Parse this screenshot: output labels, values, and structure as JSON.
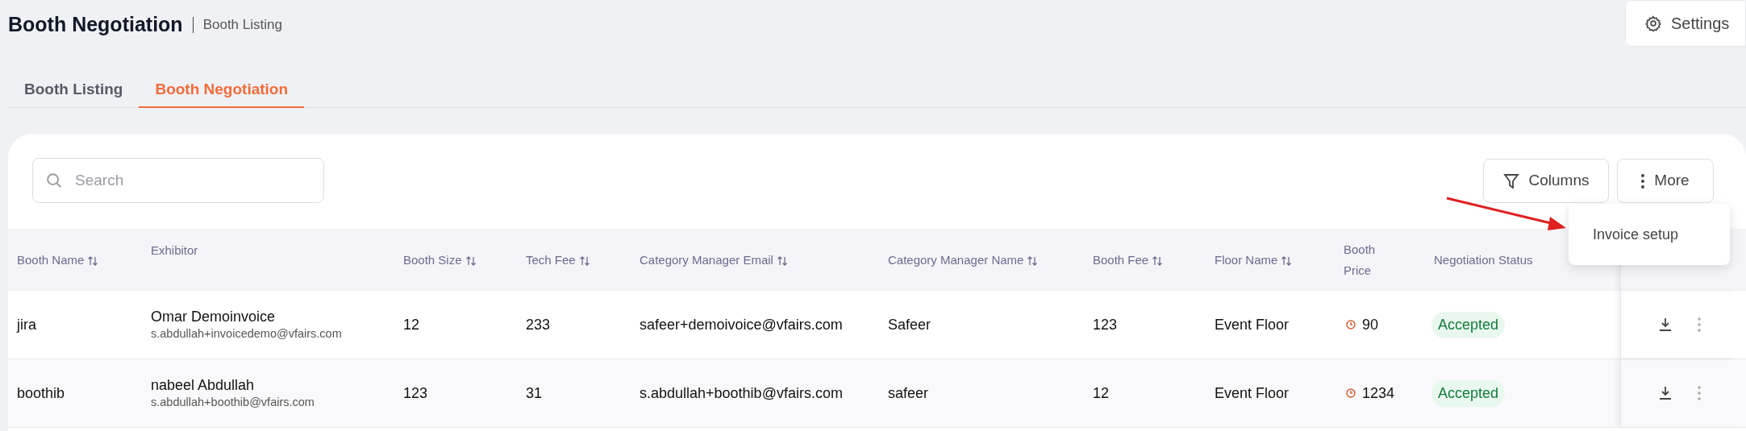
{
  "header": {
    "title": "Booth Negotiation",
    "breadcrumb": "Booth Listing",
    "settings_button": "Settings"
  },
  "tabs": [
    {
      "label": "Booth Listing",
      "selected": false
    },
    {
      "label": "Booth Negotiation",
      "selected": true
    }
  ],
  "toolbar": {
    "search": {
      "placeholder": "Search"
    },
    "columns_button": "Columns",
    "more_button": "More"
  },
  "more_menu": {
    "items": [
      "Invoice setup"
    ]
  },
  "table": {
    "columns": [
      {
        "label": "Booth Name",
        "sortable": true
      },
      {
        "label": "Exhibitor",
        "sortable": false
      },
      {
        "label": "Booth Size",
        "sortable": true
      },
      {
        "label": "Tech Fee",
        "sortable": true
      },
      {
        "label": "Category Manager Email",
        "sortable": true
      },
      {
        "label": "Category Manager Name",
        "sortable": true
      },
      {
        "label": "Booth Fee",
        "sortable": true
      },
      {
        "label": "Floor Name",
        "sortable": true
      },
      {
        "label": "Booth Price",
        "sortable": false
      },
      {
        "label": "Negotiation Status",
        "sortable": false
      }
    ],
    "rows": [
      {
        "booth_name": "jira",
        "exhibitor_name": "Omar Demoinvoice",
        "exhibitor_email": "s.abdullah+invoicedemo@vfairs.com",
        "booth_size": "12",
        "tech_fee": "233",
        "manager_email": "safeer+demoivoice@vfairs.com",
        "manager_name": "Safeer",
        "booth_fee": "123",
        "floor_name": "Event Floor",
        "booth_price": "90",
        "status": "Accepted"
      },
      {
        "booth_name": "boothib",
        "exhibitor_name": "nabeel Abdullah",
        "exhibitor_email": "s.abdullah+boothib@vfairs.com",
        "booth_size": "123",
        "tech_fee": "31",
        "manager_email": "s.abdullah+boothib@vfairs.com",
        "manager_name": "safeer",
        "booth_fee": "12",
        "floor_name": "Event Floor",
        "booth_price": "1234",
        "status": "Accepted"
      }
    ]
  }
}
